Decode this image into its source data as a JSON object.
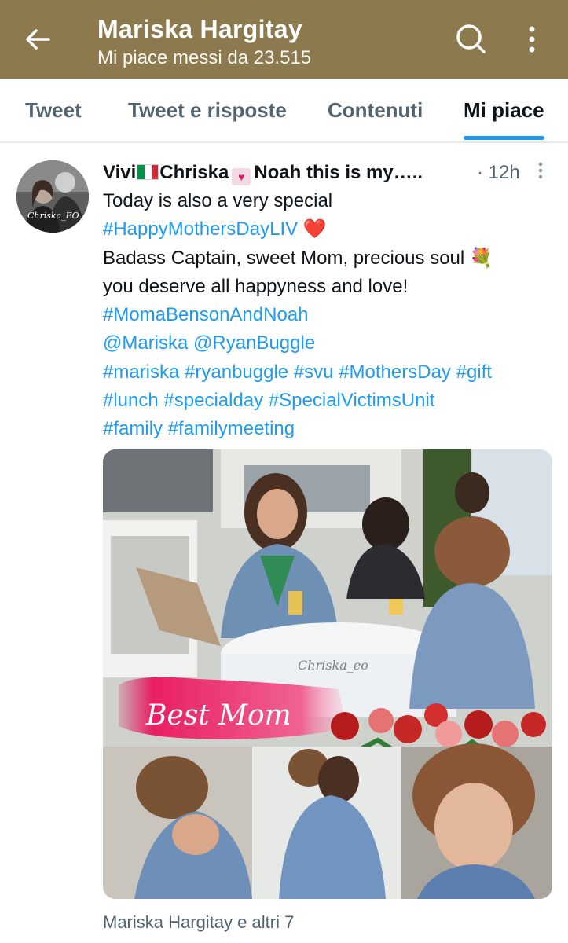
{
  "header": {
    "title": "Mariska Hargitay",
    "subtitle": "Mi piace messi da 23.515",
    "background": "#8c7a4e"
  },
  "tabs": [
    {
      "label": "Tweet"
    },
    {
      "label": "Tweet e risposte"
    },
    {
      "label": "Contenuti"
    },
    {
      "label": "Mi piace",
      "active": true
    }
  ],
  "tweet": {
    "avatar_text": "Chriska_EO",
    "name_part1": "Vivi",
    "name_part2": "Chriska",
    "name_part3": "Noah this is my…..",
    "time": "· 12h",
    "lines": {
      "l1": "Today is also a very special",
      "l2_tag": "#HappyMothersDayLIV",
      "l2_emoji": "❤️",
      "l3": "Badass Captain, sweet Mom, precious soul",
      "l3_emoji": "💐",
      "l4": "you deserve all happyness and love!",
      "l5": "#MomaBensonAndNoah",
      "l6a": "@Mariska",
      "l6b": "@RyanBuggle",
      "l7a": "#mariska",
      "l7b": "#ryanbuggle",
      "l7c": "#svu",
      "l7d": "#MothersDay",
      "l7e": "#gift",
      "l8a": "#lunch",
      "l8b": "#specialday",
      "l8c": "#SpecialVictimsUnit",
      "l9a": "#family",
      "l9b": "#familymeeting"
    },
    "media": {
      "banner_text": "Best Mom",
      "watermark": "Chriska_eo"
    },
    "liked_by": "Mariska Hargitay e altri 7"
  },
  "colors": {
    "link": "#1d9bf0",
    "secondary_text": "#536471",
    "tab_indicator": "#1d9bf0"
  }
}
